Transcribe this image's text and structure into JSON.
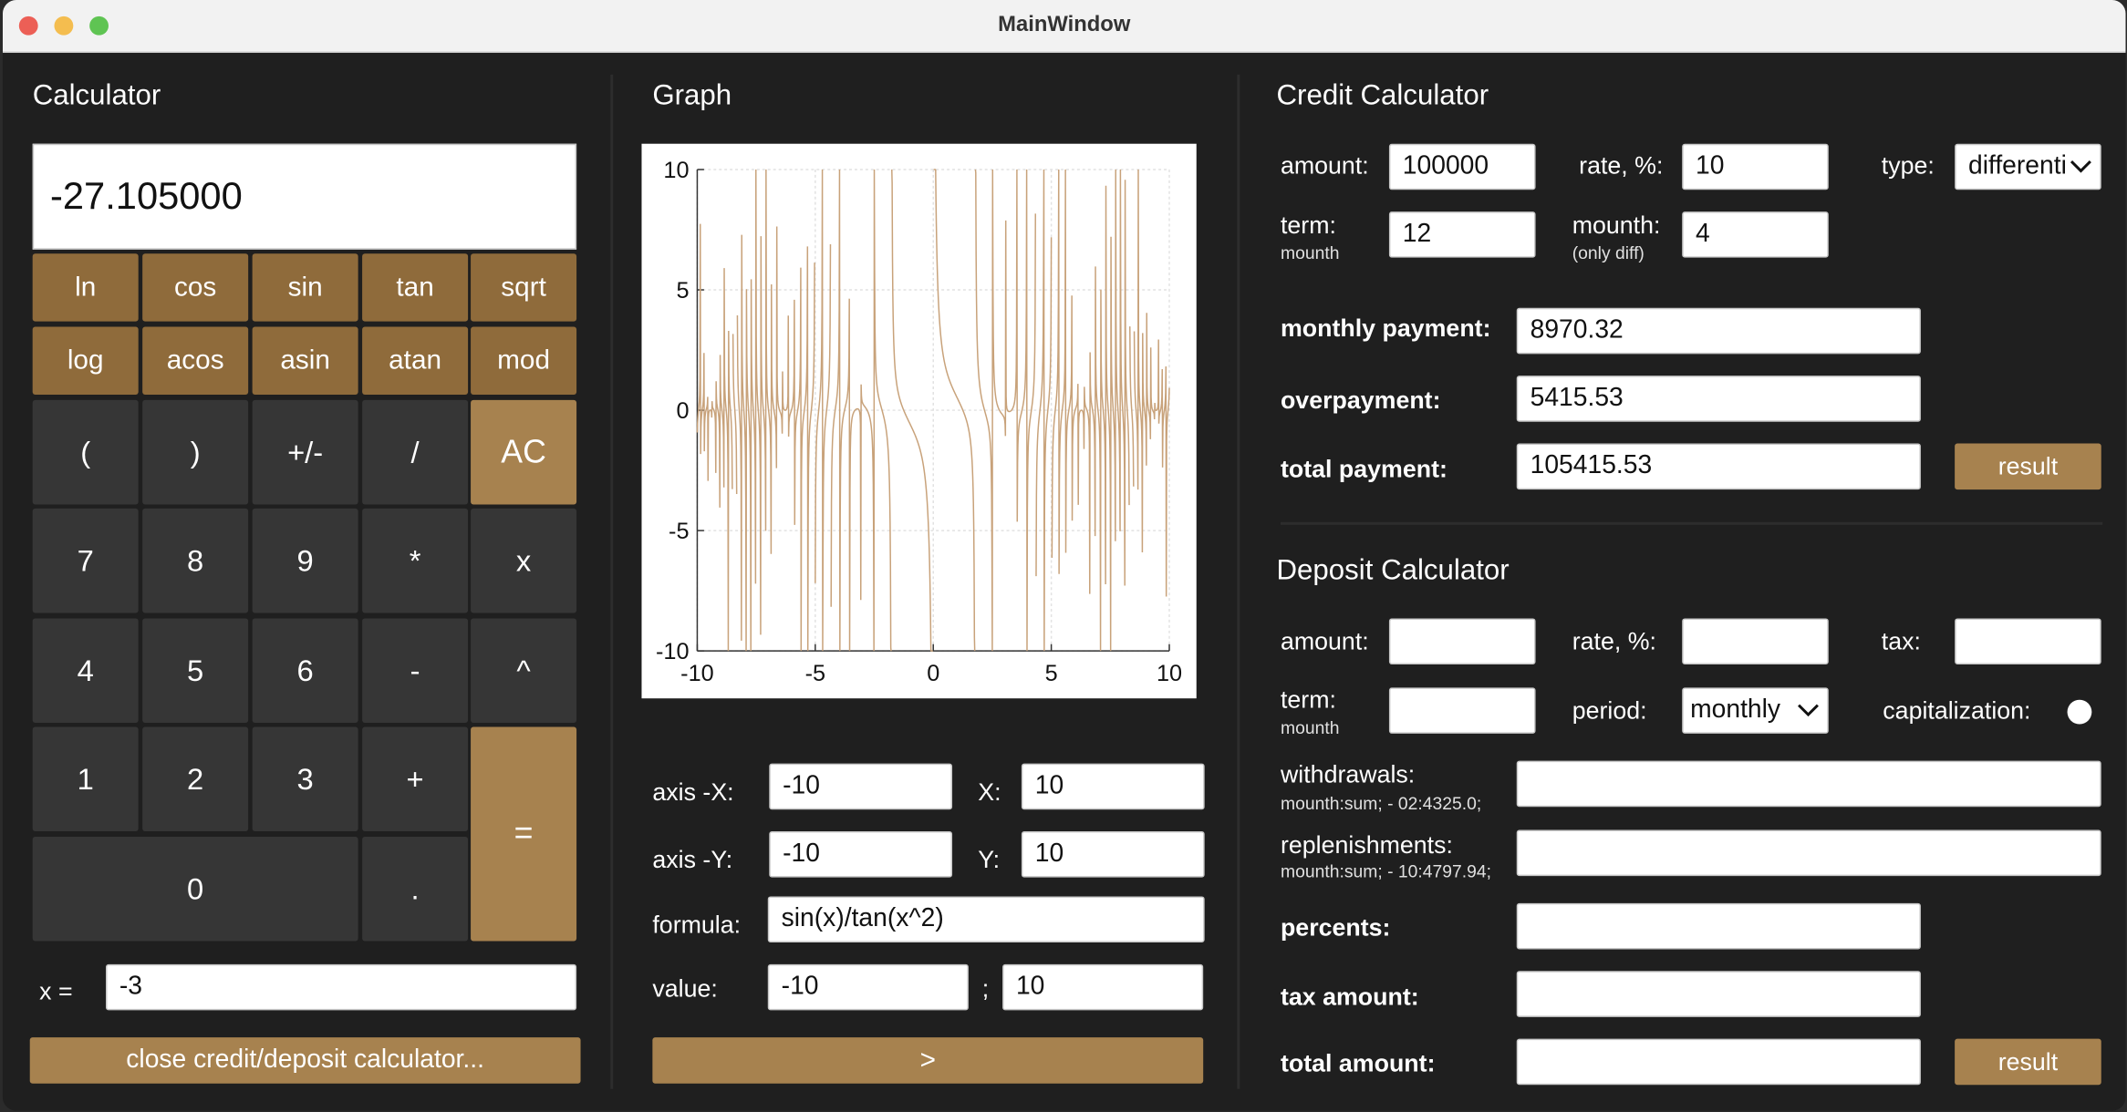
{
  "window": {
    "title": "MainWindow"
  },
  "colors": {
    "accent": "#a7824f",
    "func_button": "#8f6b3b",
    "dark_button": "#363636",
    "plot_line": "#c8a27a"
  },
  "calculator": {
    "heading": "Calculator",
    "display": "-27.105000",
    "func_row1": [
      "ln",
      "cos",
      "sin",
      "tan",
      "sqrt"
    ],
    "func_row2": [
      "log",
      "acos",
      "asin",
      "atan",
      "mod"
    ],
    "keys": {
      "lparen": "(",
      "rparen": ")",
      "plusminus": "+/-",
      "divide": "/",
      "ac": "AC",
      "seven": "7",
      "eight": "8",
      "nine": "9",
      "multiply": "*",
      "x": "x",
      "four": "4",
      "five": "5",
      "six": "6",
      "minus": "-",
      "pow": "^",
      "one": "1",
      "two": "2",
      "three": "3",
      "plus": "+",
      "equals": "=",
      "zero": "0",
      "dot": "."
    },
    "x_label": "x =",
    "x_value": "-3",
    "close_button": "close credit/deposit calculator..."
  },
  "graph": {
    "heading": "Graph",
    "axis_x_label": "axis  -X:",
    "axis_x_min": "-10",
    "x_label": "X:",
    "axis_x_max": "10",
    "axis_y_label": "axis  -Y:",
    "axis_y_min": "-10",
    "y_label": "Y:",
    "axis_y_max": "10",
    "formula_label": "formula:",
    "formula": "sin(x)/tan(x^2)",
    "value_label": "value:",
    "value_from": "-10",
    "value_sep": ";",
    "value_to": "10",
    "run_button": ">"
  },
  "chart_data": {
    "type": "line",
    "function": "sin(x)/tan(x^2)",
    "xlim": [
      -10,
      10
    ],
    "ylim": [
      -10,
      10
    ],
    "x_ticks": [
      "-10",
      "-5",
      "0",
      "5",
      "10"
    ],
    "y_ticks": [
      "10",
      "5",
      "0",
      "-5",
      "-10"
    ],
    "grid": true
  },
  "credit": {
    "heading": "Credit Calculator",
    "amount_label": "amount:",
    "amount": "100000",
    "rate_label": "rate, %:",
    "rate": "10",
    "type_label": "type:",
    "type": "differenti",
    "term_label": "term:",
    "term_sub": "mounth",
    "term": "12",
    "mounth_label": "mounth:",
    "mounth_sub": "(only diff)",
    "mounth": "4",
    "monthly_label": "monthly payment:",
    "monthly": "8970.32",
    "over_label": "overpayment:",
    "over": "5415.53",
    "total_label": "total payment:",
    "total": "105415.53",
    "result_button": "result"
  },
  "deposit": {
    "heading": "Deposit Calculator",
    "amount_label": "amount:",
    "amount": "",
    "rate_label": "rate, %:",
    "rate": "",
    "tax_label": "tax:",
    "tax": "",
    "term_label": "term:",
    "term_sub": "mounth",
    "term": "",
    "period_label": "period:",
    "period": "monthly",
    "cap_label": "capitalization:",
    "withdrawals_label": "withdrawals:",
    "withdrawals_hint": "mounth:sum; - 02:4325.0;",
    "withdrawals": "",
    "replenish_label": "replenishments:",
    "replenish_hint": "mounth:sum; - 10:4797.94;",
    "replenish": "",
    "percents_label": "percents:",
    "percents": "",
    "taxamt_label": "tax amount:",
    "taxamt": "",
    "totalamt_label": "total amount:",
    "totalamt": "",
    "result_button": "result"
  }
}
